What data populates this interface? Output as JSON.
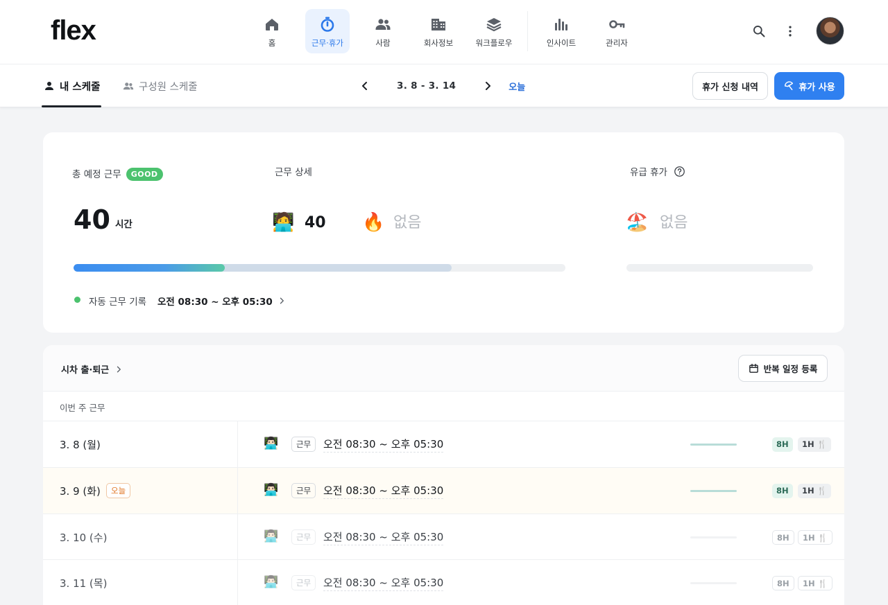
{
  "app": {
    "logo": "flex"
  },
  "nav": {
    "items": [
      {
        "label": "홈",
        "icon": "home-icon"
      },
      {
        "label": "근무·휴가",
        "icon": "stopwatch-icon",
        "active": true
      },
      {
        "label": "사람",
        "icon": "people-icon"
      },
      {
        "label": "회사정보",
        "icon": "building-icon"
      },
      {
        "label": "워크플로우",
        "icon": "layers-icon"
      },
      {
        "label": "인사이트",
        "icon": "bar-chart-icon"
      },
      {
        "label": "관리자",
        "icon": "key-icon"
      }
    ],
    "search_icon": "search-icon",
    "more_icon": "more-vertical-icon"
  },
  "subnav": {
    "tab_mine": "내 스케줄",
    "tab_members": "구성원 스케줄",
    "range": "3. 8 - 3. 14",
    "today": "오늘",
    "history_button": "휴가 신청 내역",
    "use_button": "휴가 사용"
  },
  "summary": {
    "total_label": "총 예정 근무",
    "good_badge": "GOOD",
    "hours": "40",
    "hours_unit": "시간",
    "detail_label": "근무 상세",
    "work_emoji": "🧑‍💻",
    "work_value": "40",
    "overtime_emoji": "🔥",
    "overtime_value": "없음",
    "paid_label": "유급 휴가",
    "vacation_emoji": "🏖️",
    "vacation_value": "없음",
    "progress": {
      "done_fraction": 0.307,
      "scheduled_fraction": 0.768
    },
    "record_label": "자동 근무 기록",
    "record_value": "오전 08:30 ~ 오후 05:30"
  },
  "schedule": {
    "flex_link": "시차 출·퇴근",
    "repeat_button": "반복 일정 등록",
    "week_label": "이번 주 근무",
    "rows": [
      {
        "date": "3. 8 (월)",
        "emoji": "👨🏻‍💻",
        "tag": "근무",
        "time": "오전 08:30 ~ 오후 05:30",
        "hours": "8H",
        "break": "1H 🍴",
        "state": "past"
      },
      {
        "date": "3. 9 (화)",
        "today_badge": "오늘",
        "emoji": "👨🏻‍💻",
        "tag": "근무",
        "time": "오전 08:30 ~ 오후 05:30",
        "hours": "8H",
        "break": "1H 🍴",
        "state": "today"
      },
      {
        "date": "3. 10 (수)",
        "emoji": "👨🏻‍💻",
        "tag": "근무",
        "time": "오전 08:30 ~ 오후 05:30",
        "hours": "8H",
        "break": "1H 🍴",
        "state": "future"
      },
      {
        "date": "3. 11 (목)",
        "emoji": "👨🏻‍💻",
        "tag": "근무",
        "time": "오전 08:30 ~ 오후 05:30",
        "hours": "8H",
        "break": "1H 🍴",
        "state": "future"
      }
    ]
  },
  "colors": {
    "accent": "#2f80f0",
    "good": "#4cc26e",
    "progress_start": "#3b8df0",
    "progress_end": "#5ac9a8",
    "scheduled": "#cfdbe8",
    "today_row": "#fffcf5"
  }
}
